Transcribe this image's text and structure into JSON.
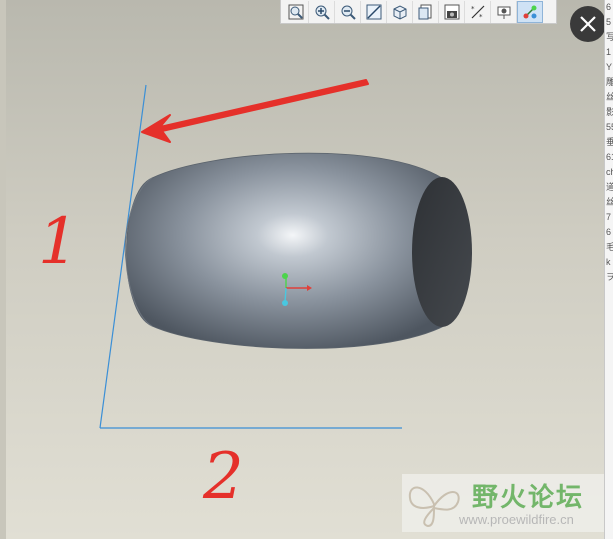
{
  "toolbar": {
    "buttons": [
      {
        "icon": "zoom-window-icon"
      },
      {
        "icon": "zoom-in-icon"
      },
      {
        "icon": "zoom-out-icon"
      },
      {
        "icon": "repaint-icon"
      },
      {
        "icon": "view-orientation-icon"
      },
      {
        "icon": "saved-views-icon"
      },
      {
        "icon": "snapshot-camera-icon"
      },
      {
        "icon": "datum-planes-icon"
      },
      {
        "icon": "datum-axes-icon"
      },
      {
        "icon": "datum-csys-icon",
        "active": true
      }
    ]
  },
  "close_button": {
    "icon": "close-icon"
  },
  "annotations": {
    "label_1": "1",
    "label_2": "2"
  },
  "colors": {
    "annotation_red": "#e5302a",
    "datum_blue": "#3b8fd6",
    "model_gray": "#7d8793"
  },
  "watermark": {
    "title": "野火论坛",
    "url": "www.proewildfire.cn"
  },
  "right_panel": {
    "fragments": [
      "6",
      "5",
      "写",
      "1",
      "Y",
      "雕",
      "丝",
      "影",
      "55",
      "垂",
      "61",
      "ch",
      "道",
      "丝",
      "7",
      "6",
      "毛",
      "k",
      "ヲ"
    ]
  }
}
